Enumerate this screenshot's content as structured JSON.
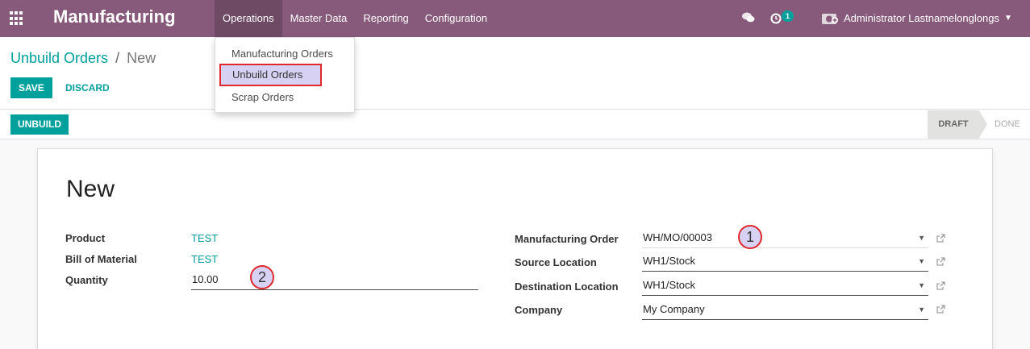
{
  "navbar": {
    "app_title": "Manufacturing",
    "menu": [
      "Operations",
      "Master Data",
      "Reporting",
      "Configuration"
    ],
    "activity_count": "1",
    "user_name": "Administrator Lastnamelonglongs"
  },
  "dropdown": {
    "items": [
      "Manufacturing Orders",
      "Unbuild Orders",
      "Scrap Orders"
    ]
  },
  "breadcrumb": {
    "parent": "Unbuild Orders",
    "separator": "/",
    "current": "New"
  },
  "buttons": {
    "save": "SAVE",
    "discard": "DISCARD",
    "unbuild": "UNBUILD"
  },
  "statusbar": {
    "stages": [
      "DRAFT",
      "DONE"
    ],
    "active_stage": "DRAFT"
  },
  "form": {
    "title": "New",
    "left": [
      {
        "label": "Product",
        "value": "TEST"
      },
      {
        "label": "Bill of Material",
        "value": "TEST"
      },
      {
        "label": "Quantity",
        "value": "10.00"
      }
    ],
    "right": [
      {
        "label": "Manufacturing Order",
        "value": "WH/MO/00003"
      },
      {
        "label": "Source Location",
        "value": "WH1/Stock"
      },
      {
        "label": "Destination Location",
        "value": "WH1/Stock"
      },
      {
        "label": "Company",
        "value": "My Company"
      }
    ]
  },
  "callouts": [
    "1",
    "2"
  ],
  "colors": {
    "navbar": "#875a7b",
    "primary": "#00a09d",
    "highlight_border": "#e0292d",
    "highlight_fill": "#d7d2f4"
  }
}
